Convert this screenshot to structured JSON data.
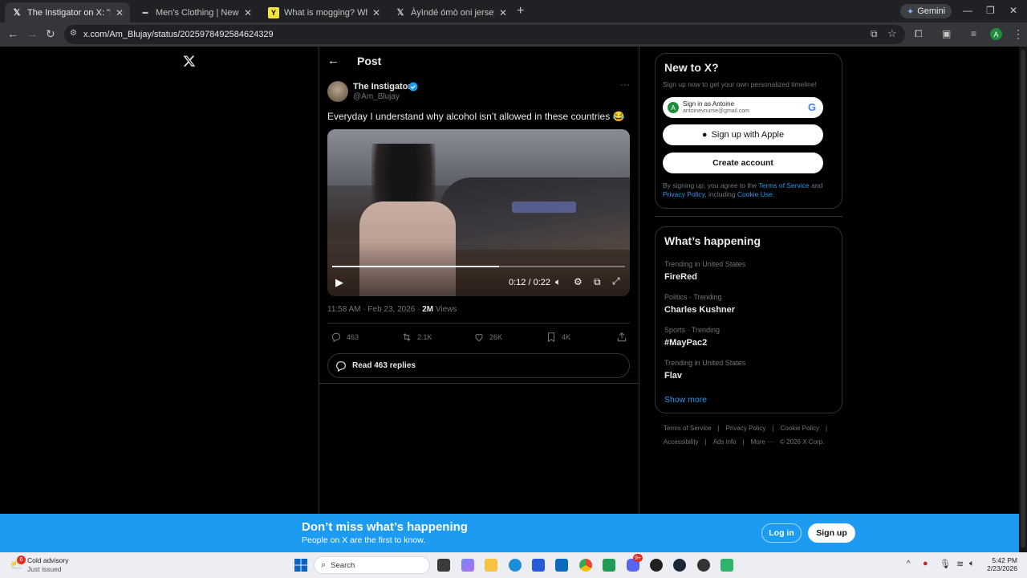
{
  "browser": {
    "tabs": [
      {
        "title": "The Instigator on X: \"Everyday I",
        "favicon": "x-logo-icon",
        "active": true
      },
      {
        "title": "Men's Clothing | New Men's Ou",
        "favicon": "brand-icon",
        "active": false
      },
      {
        "title": "What is mogging? What is look",
        "favicon": "yahoo-icon",
        "active": false
      },
      {
        "title": "Àyìndé ómò oni jersey 😍💗 o",
        "favicon": "x-logo-icon",
        "active": false
      }
    ],
    "gemini_label": "Gemini",
    "url": "x.com/Am_Blujay/status/2025978492584624329",
    "profile_initial": "A"
  },
  "post": {
    "header_title": "Post",
    "author_name": "The Instigator",
    "author_handle": "@Am_Blujay",
    "text": "Everyday I understand why alcohol isn’t allowed in these countries 😂",
    "video_time": "0:12 / 0:22",
    "video_progress": 0.57,
    "timestamp": "11:58 AM · Feb 23, 2026 · ",
    "views_count": "2M",
    "views_label": " Views",
    "replies": "463",
    "reposts": "2.1K",
    "likes": "26K",
    "bookmarks": "4K",
    "read_replies": "Read 463 replies"
  },
  "signup_card": {
    "title": "New to X?",
    "subtitle": "Sign up now to get your own personalized timeline!",
    "google_name": "Sign in as Antoine",
    "google_email": "antoinevnurse@gmail.com",
    "google_initial": "A",
    "apple_label": "Sign up with Apple",
    "create_label": "Create account",
    "terms_prefix": "By signing up, you agree to the ",
    "terms_link": "Terms of Service",
    "terms_and": " and ",
    "privacy_link": "Privacy Policy",
    "including": ", including ",
    "cookie_link": "Cookie Use",
    "period": "."
  },
  "trending": {
    "title": "What’s happening",
    "items": [
      {
        "meta": "Trending in United States",
        "name": "FireRed"
      },
      {
        "meta": "Politics · Trending",
        "name": "Charles Kushner"
      },
      {
        "meta": "Sports · Trending",
        "name": "#MayPac2"
      },
      {
        "meta": "Trending in United States",
        "name": "Flav"
      }
    ],
    "show_more": "Show more"
  },
  "footer": {
    "links": [
      "Terms of Service",
      "Privacy Policy",
      "Cookie Policy",
      "Accessibility",
      "Ads info",
      "More ···"
    ],
    "copyright": "© 2026 X Corp."
  },
  "banner": {
    "title": "Don’t miss what’s happening",
    "subtitle": "People on X are the first to know.",
    "login": "Log in",
    "signup": "Sign up"
  },
  "taskbar": {
    "weather_badge": "6",
    "weather_title": "Cold advisory",
    "weather_sub": "Just issued",
    "search_placeholder": "Search",
    "time": "5:42 PM",
    "date": "2/23/2026",
    "notif_badge": "9+"
  }
}
